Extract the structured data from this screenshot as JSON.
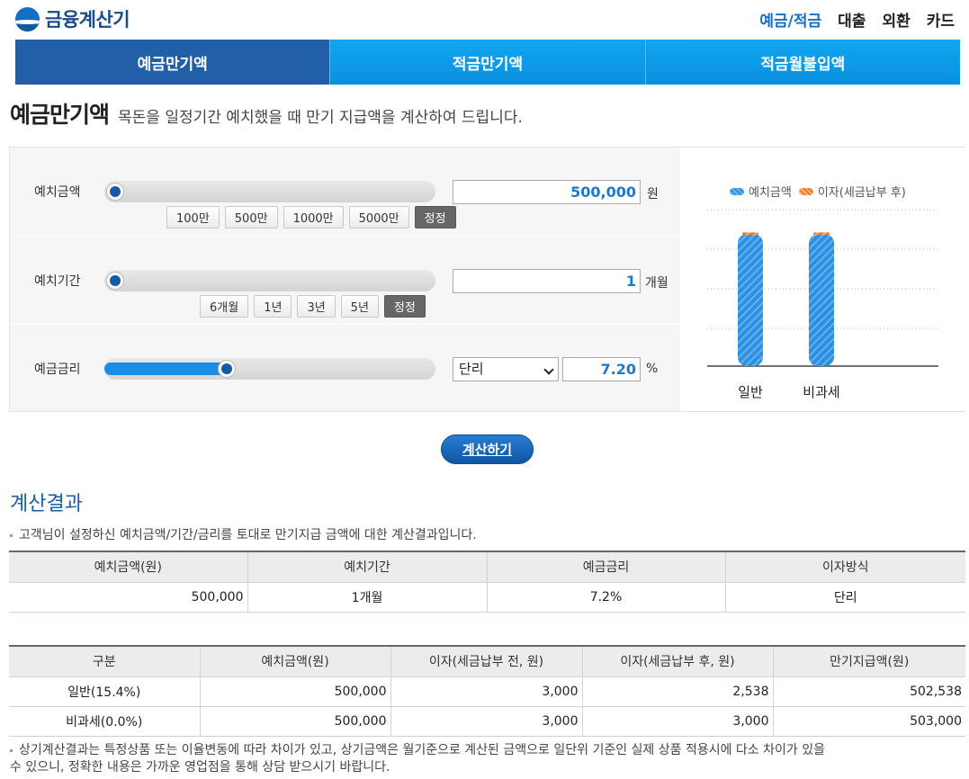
{
  "header": {
    "logo_text": "금융계산기",
    "nav": [
      "예금/적금",
      "대출",
      "외환",
      "카드"
    ]
  },
  "tabs": [
    "예금만기액",
    "적금만기액",
    "적금월불입액"
  ],
  "page": {
    "title": "예금만기액",
    "description": "목돈을 일정기간 예치했을 때 만기 지급액을 계산하여 드립니다."
  },
  "calculator": {
    "deposit": {
      "label": "예치금액",
      "value": "500,000",
      "unit": "원",
      "slider_fraction": 0.0,
      "buttons": [
        "100만",
        "500만",
        "1000만",
        "5000만"
      ],
      "reset": "정정"
    },
    "period": {
      "label": "예치기간",
      "value": "1",
      "unit": "개월",
      "slider_fraction": 0.0,
      "buttons": [
        "6개월",
        "1년",
        "3년",
        "5년"
      ],
      "reset": "정정"
    },
    "rate": {
      "label": "예금금리",
      "interest_type": "단리",
      "value": "7.20",
      "unit": "%",
      "slider_fraction": 0.36
    },
    "calculate_button": "계산하기"
  },
  "chart_data": {
    "type": "bar",
    "categories": [
      "일반",
      "비과세"
    ],
    "series": [
      {
        "name": "예치금액",
        "values": [
          500000,
          500000
        ],
        "color": "#2e8fe0"
      },
      {
        "name": "이자(세금납부 후)",
        "values": [
          2538,
          3000
        ],
        "color": "#f07a22"
      }
    ],
    "stacked": true,
    "ylim": [
      0,
      600000
    ],
    "grid": true,
    "legend": "top"
  },
  "results": {
    "title": "계산결과",
    "note": "고객님이 설정하신 예치금액/기간/금리를 토대로 만기지급 금액에 대한 계산결과입니다.",
    "summary": {
      "headers": [
        "예치금액(원)",
        "예치기간",
        "예금금리",
        "이자방식"
      ],
      "row": [
        "500,000",
        "1개월",
        "7.2%",
        "단리"
      ]
    },
    "detail": {
      "headers": [
        "구분",
        "예치금액(원)",
        "이자(세금납부 전, 원)",
        "이자(세금납부 후, 원)",
        "만기지급액(원)"
      ],
      "rows": [
        [
          "일반(15.4%)",
          "500,000",
          "3,000",
          "2,538",
          "502,538"
        ],
        [
          "비과세(0.0%)",
          "500,000",
          "3,000",
          "3,000",
          "503,000"
        ]
      ]
    },
    "footnote_line1": "상기계산결과는 특정상품 또는 이율변동에 따라 차이가 있고, 상기금액은 월기준으로 계산된 금액으로 일단위 기준인 실제 상품 적용시에 다소 차이가 있을",
    "footnote_line2": "수 있으니, 정확한 내용은 가까운 영업점을 통해 상담 받으시기 바랍니다."
  }
}
